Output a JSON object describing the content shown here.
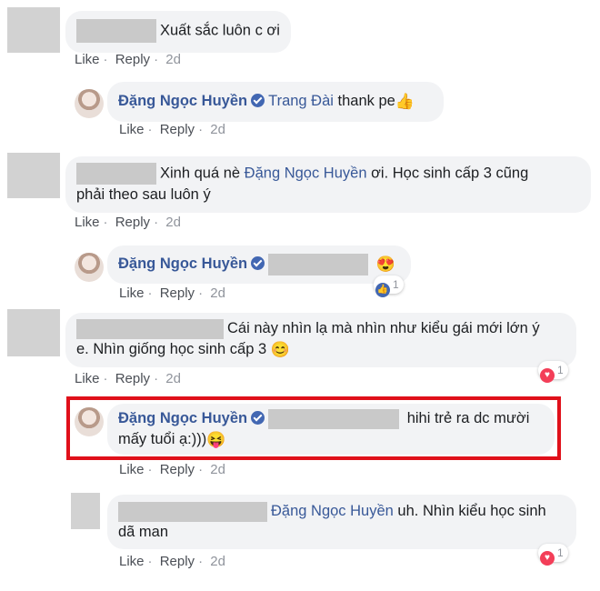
{
  "comments": [
    {
      "text": "Xuất sắc luôn c ơi",
      "actions": {
        "like": "Like",
        "reply": "Reply",
        "time": "2d"
      }
    },
    {
      "author": "Đặng Ngọc Huyền",
      "mention": "Trang Đài",
      "text": "thank pe",
      "emoji": "👍",
      "actions": {
        "like": "Like",
        "reply": "Reply",
        "time": "2d"
      }
    },
    {
      "text_pre": "Xinh quá nè",
      "mention": "Đặng Ngọc Huyền",
      "text_post": "ơi. Học sinh cấp 3 cũng",
      "text_line2": "phải theo sau luôn ý",
      "actions": {
        "like": "Like",
        "reply": "Reply",
        "time": "2d"
      }
    },
    {
      "author": "Đặng Ngọc Huyền",
      "emoji": "😍",
      "reaction_count": "1",
      "actions": {
        "like": "Like",
        "reply": "Reply",
        "time": "2d"
      }
    },
    {
      "text": "Cái này nhìn lạ mà nhìn như kiểu gái mới lớn ý",
      "text_line2": "e. Nhìn giống học sinh cấp 3",
      "emoji": "😊",
      "reaction_count": "1",
      "actions": {
        "like": "Like",
        "reply": "Reply",
        "time": "2d"
      }
    },
    {
      "author": "Đặng Ngọc Huyền",
      "text": "hihi trẻ ra dc mười",
      "text_line2": "mấy tuổi ạ:)))",
      "emoji": "😝",
      "actions": {
        "like": "Like",
        "reply": "Reply",
        "time": "2d"
      }
    },
    {
      "mention": "Đặng Ngọc Huyền",
      "text": "uh. Nhìn kiểu học sinh",
      "text_line2": "dã man",
      "reaction_count": "1",
      "actions": {
        "like": "Like",
        "reply": "Reply",
        "time": "2d"
      }
    }
  ],
  "colors": {
    "link": "#385898",
    "bubble": "#f2f3f5",
    "highlight": "#e0101a",
    "like_blue": "#4267b2",
    "love_red": "#f33e58"
  },
  "icons": [
    "verified-badge-icon",
    "like-reaction-icon",
    "love-reaction-icon"
  ]
}
